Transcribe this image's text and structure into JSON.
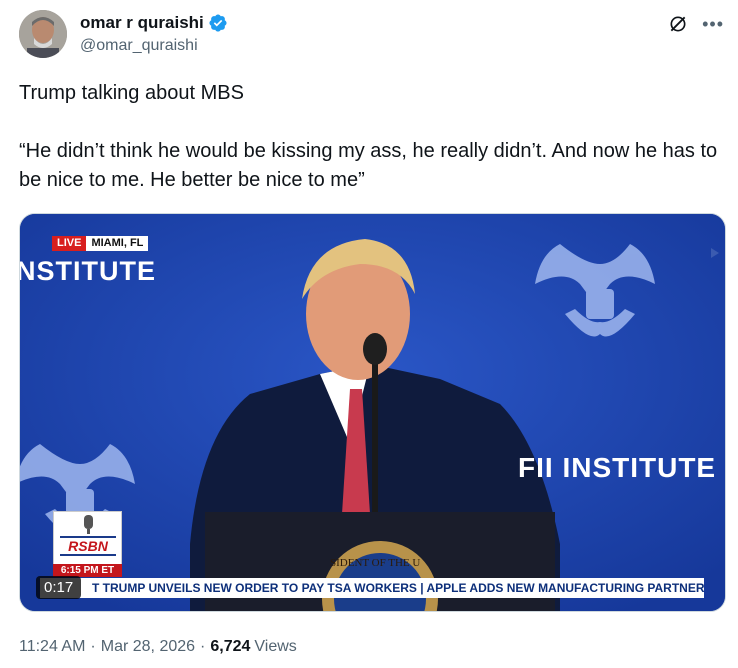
{
  "author": {
    "name": "omar r quraishi",
    "handle": "@omar_quraishi",
    "verified": true,
    "verified_color": "#1d9bf0"
  },
  "tweet": {
    "text": "Trump talking about MBS\n\n“He didn’t think he would be kissing my ass, he really didn’t. And now he has to be nice to me. He better be nice to me”"
  },
  "media": {
    "live_label": "LIVE",
    "location": "MIAMI, FL",
    "logo_text_left": "NSTITUTE",
    "logo_text_right": "FII INSTITUTE",
    "channel": "RSBN",
    "channel_time": "6:15 PM ET",
    "ticker": "T TRUMP UNVEILS NEW ORDER TO PAY TSA WORKERS | APPLE ADDS NEW MANUFACTURING PARTNERS AS PRI",
    "timer": "0:17",
    "seal_text": "SIDENT OF THE U"
  },
  "meta": {
    "time": "11:24 AM",
    "date": "Mar 28, 2026",
    "views": "6,724",
    "views_label": "Views",
    "separator": "·"
  },
  "icons": {
    "grok": "grok-icon",
    "more": "more-icon",
    "verified": "verified-badge-icon"
  }
}
